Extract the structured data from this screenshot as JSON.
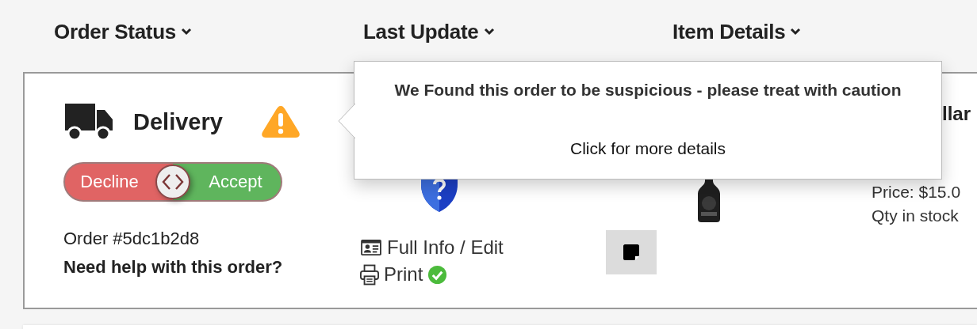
{
  "columns": [
    {
      "label": "Order Status"
    },
    {
      "label": "Last Update"
    },
    {
      "label": "Item Details"
    }
  ],
  "order": {
    "type": "Delivery",
    "warning": true,
    "swipe": {
      "decline": "Decline",
      "accept": "Accept",
      "level": 0.5
    },
    "number": "Order #5dc1b2d8",
    "help": "Need help with this order?"
  },
  "update": {
    "full_info": "Full Info / Edit",
    "print": "Print",
    "printed": true
  },
  "item": {
    "name": "llar",
    "price": "Price: $15.0",
    "stock": "Qty in stock"
  },
  "popover": {
    "title": "We Found this order to be suspicious - please treat with caution",
    "link": "Click for more details"
  }
}
